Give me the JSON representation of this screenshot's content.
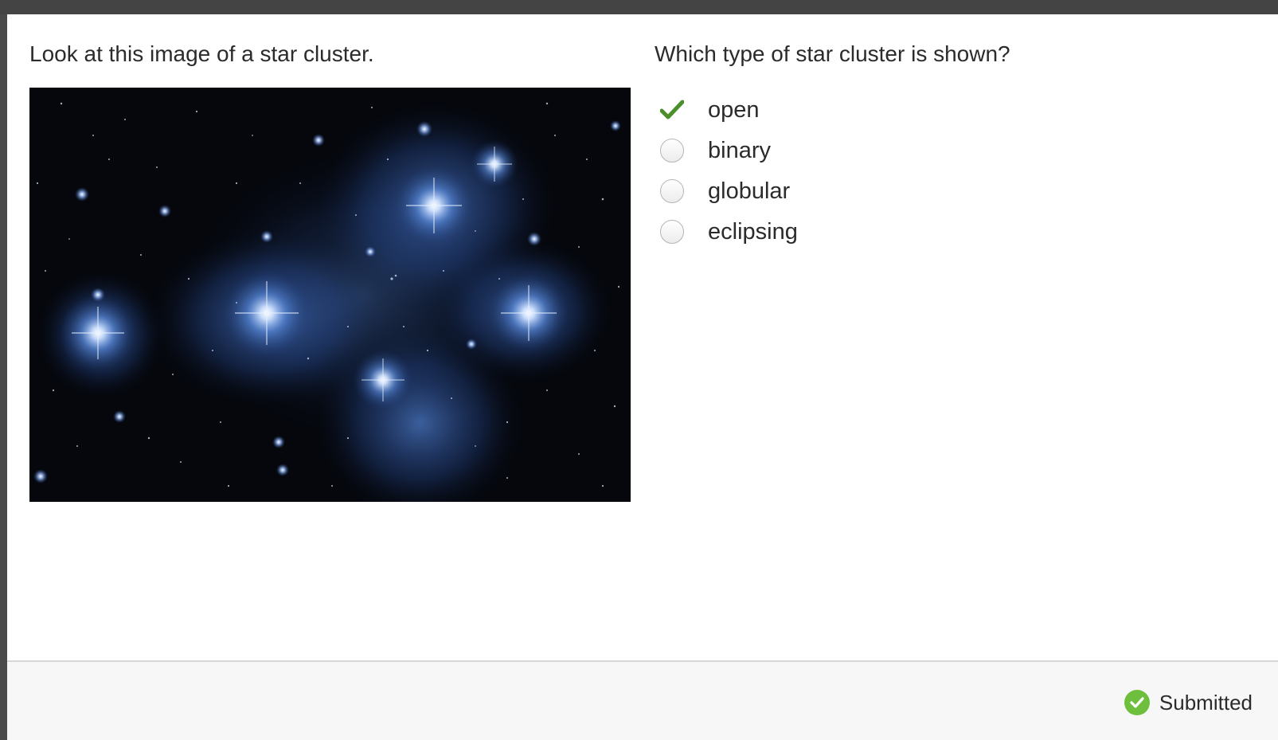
{
  "question": {
    "stimulus_text": "Look at this image of a star cluster.",
    "prompt": "Which type of star cluster is shown?",
    "options": [
      {
        "label": "open",
        "selected": true,
        "marker": "checkmark-icon"
      },
      {
        "label": "binary",
        "selected": false,
        "marker": "radio-button"
      },
      {
        "label": "globular",
        "selected": false,
        "marker": "radio-button"
      },
      {
        "label": "eclipsing",
        "selected": false,
        "marker": "radio-button"
      }
    ]
  },
  "footer": {
    "status_label": "Submitted",
    "status_icon": "check-circle-icon"
  },
  "colors": {
    "check_green": "#4a8f2c",
    "status_green": "#6fbf3f",
    "top_bar": "#444444"
  }
}
